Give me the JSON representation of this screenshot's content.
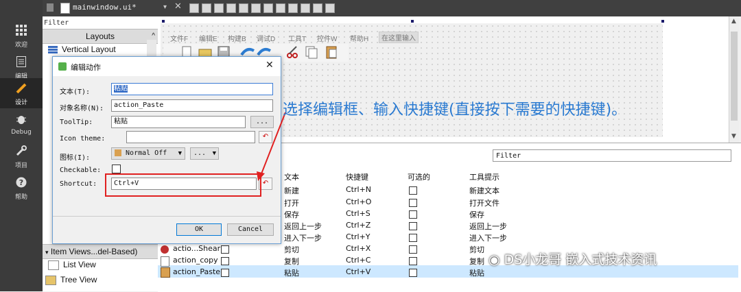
{
  "modebar": [
    {
      "label": "欢迎",
      "icon": "grid-icon"
    },
    {
      "label": "编辑",
      "icon": "document-icon"
    },
    {
      "label": "设计",
      "icon": "pen-icon"
    },
    {
      "label": "Debug",
      "icon": "bug-icon"
    },
    {
      "label": "项目",
      "icon": "wrench-icon"
    },
    {
      "label": "帮助",
      "icon": "help-icon"
    }
  ],
  "topbar": {
    "file_tab": "mainwindow.ui*"
  },
  "widgetbox": {
    "filter_placeholder": "Filter",
    "layouts_header": "Layouts",
    "vertical_layout": "Vertical Layout",
    "item_views_header": "Item Views...del-Based)",
    "list_view": "List View",
    "tree_view": "Tree View"
  },
  "form": {
    "menus": [
      "文件F",
      "编辑E",
      "构建B",
      "调试D",
      "工具T",
      "控件W",
      "帮助H"
    ],
    "menu_input": "在这里输入"
  },
  "action_editor": {
    "filter_placeholder": "Filter",
    "headers": [
      "文本",
      "快捷键",
      "可选的",
      "工具提示"
    ],
    "rows": [
      {
        "name": "",
        "text": "新建",
        "shortcut": "Ctrl+N",
        "tooltip": "新建文本"
      },
      {
        "name": "",
        "text": "打开",
        "shortcut": "Ctrl+O",
        "tooltip": "打开文件"
      },
      {
        "name": "",
        "text": "保存",
        "shortcut": "Ctrl+S",
        "tooltip": "保存"
      },
      {
        "name": "",
        "text": "返回上一步",
        "shortcut": "Ctrl+Z",
        "tooltip": "返回上一步"
      },
      {
        "name": "",
        "text": "进入下一步",
        "shortcut": "Ctrl+Y",
        "tooltip": "进入下一步"
      },
      {
        "name": "actio...Shear",
        "text": "剪切",
        "shortcut": "Ctrl+X",
        "tooltip": "剪切"
      },
      {
        "name": "action_copy",
        "text": "复制",
        "shortcut": "Ctrl+C",
        "tooltip": "复制"
      },
      {
        "name": "action_Paste",
        "text": "粘贴",
        "shortcut": "Ctrl+V",
        "tooltip": "粘贴"
      }
    ]
  },
  "dialog": {
    "title": "编辑动作",
    "text_label": "文本(T):",
    "text_value": "粘贴",
    "objname_label": "对象名称(N):",
    "objname_value": "action_Paste",
    "tooltip_label": "ToolTip:",
    "tooltip_value": "粘贴",
    "more": "...",
    "icontheme_label": "Icon theme:",
    "icon_label": "图标(I):",
    "icon_value": "Normal Off",
    "checkable_label": "Checkable:",
    "shortcut_label": "Shortcut:",
    "shortcut_value": "Ctrl+V",
    "ok": "OK",
    "cancel": "Cancel"
  },
  "annotation": "选择编辑框、输入快捷键(直接按下需要的快捷键)。",
  "watermark": "DS小龙哥 嵌入式技术资讯",
  "colors": {
    "highlight": "#316ac5",
    "annotation": "#2a7ad1",
    "callout": "#e02020",
    "selected_row": "#cde8ff"
  }
}
